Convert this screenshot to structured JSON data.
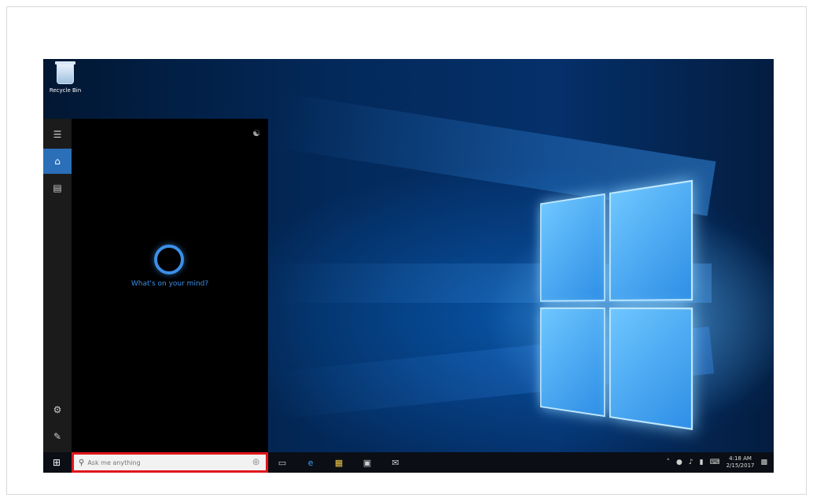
{
  "desktop": {
    "recycle_bin_label": "Recycle Bin"
  },
  "cortana": {
    "prompt": "What's on your mind?"
  },
  "taskbar": {
    "search": {
      "placeholder": "Ask me anything"
    },
    "clock": {
      "time": "4:18 AM",
      "date": "2/15/2017"
    },
    "pinned_icons": [
      "task-view-icon",
      "edge-icon",
      "file-explorer-icon",
      "store-icon",
      "mail-icon"
    ],
    "tray_icons": [
      "chevron-up-icon",
      "network-icon",
      "volume-icon",
      "battery-icon",
      "keyboard-icon",
      "notifications-icon"
    ]
  },
  "colors": {
    "accent": "#2a6fb8",
    "cortana_blue": "#3b8fe8",
    "highlight_box": "#e0161b"
  }
}
